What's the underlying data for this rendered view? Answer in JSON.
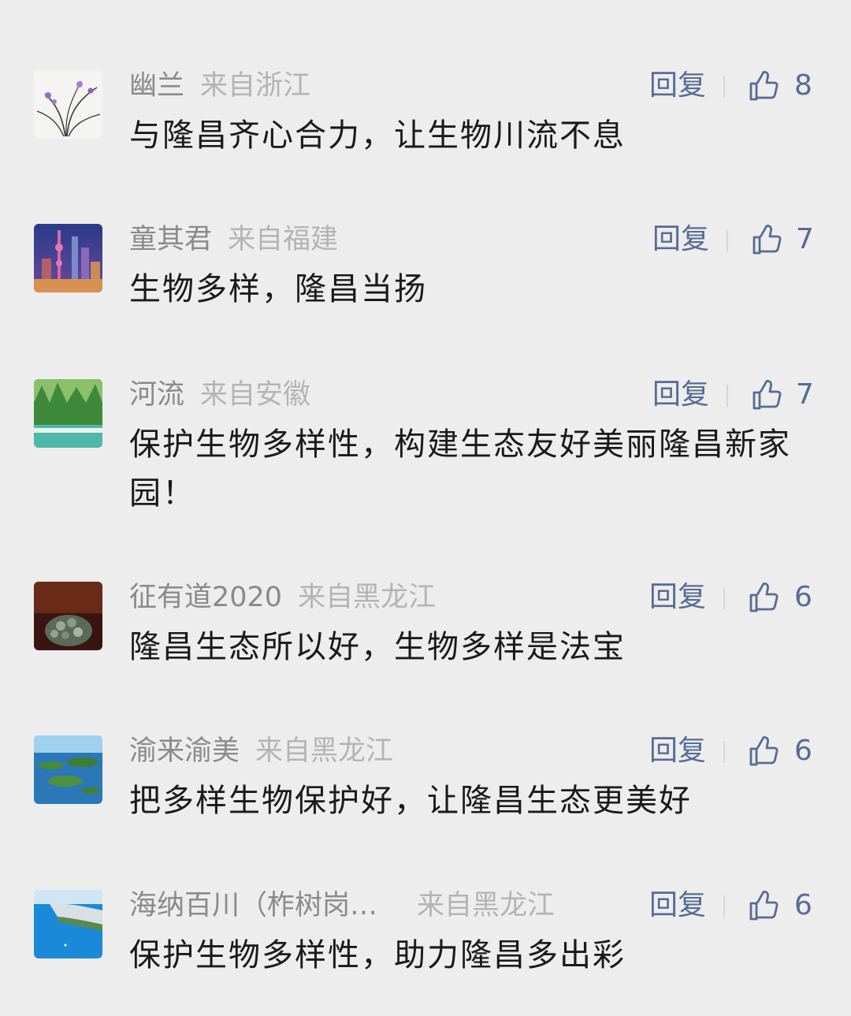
{
  "comments": [
    {
      "nickname": "幽兰",
      "region": "来自浙江",
      "reply_label": "回复",
      "likes": "8",
      "content": "与隆昌齐心合力，让生物川流不息",
      "avatar_icon": "orchid-avatar"
    },
    {
      "nickname": "童其君",
      "region": "来自福建",
      "reply_label": "回复",
      "likes": "7",
      "content": "生物多样，隆昌当扬",
      "avatar_icon": "city-skyline-avatar"
    },
    {
      "nickname": "河流",
      "region": "来自安徽",
      "reply_label": "回复",
      "likes": "7",
      "content": "保护生物多样性，构建生态友好美丽隆昌新家园！",
      "avatar_icon": "forest-waterfall-avatar"
    },
    {
      "nickname": "征有道2020",
      "region": "来自黑龙江",
      "reply_label": "回复",
      "likes": "6",
      "content": "隆昌生态所以好，生物多样是法宝",
      "avatar_icon": "succulent-avatar"
    },
    {
      "nickname": "渝来渝美",
      "region": "来自黑龙江",
      "reply_label": "回复",
      "likes": "6",
      "content": "把多样生物保护好，让隆昌生态更美好",
      "avatar_icon": "lake-islands-avatar"
    },
    {
      "nickname": "海纳百川（柞树岗…",
      "region": "来自黑龙江",
      "reply_label": "回复",
      "likes": "6",
      "content": "保护生物多样性，助力隆昌多出彩",
      "avatar_icon": "sea-cliff-avatar"
    }
  ]
}
